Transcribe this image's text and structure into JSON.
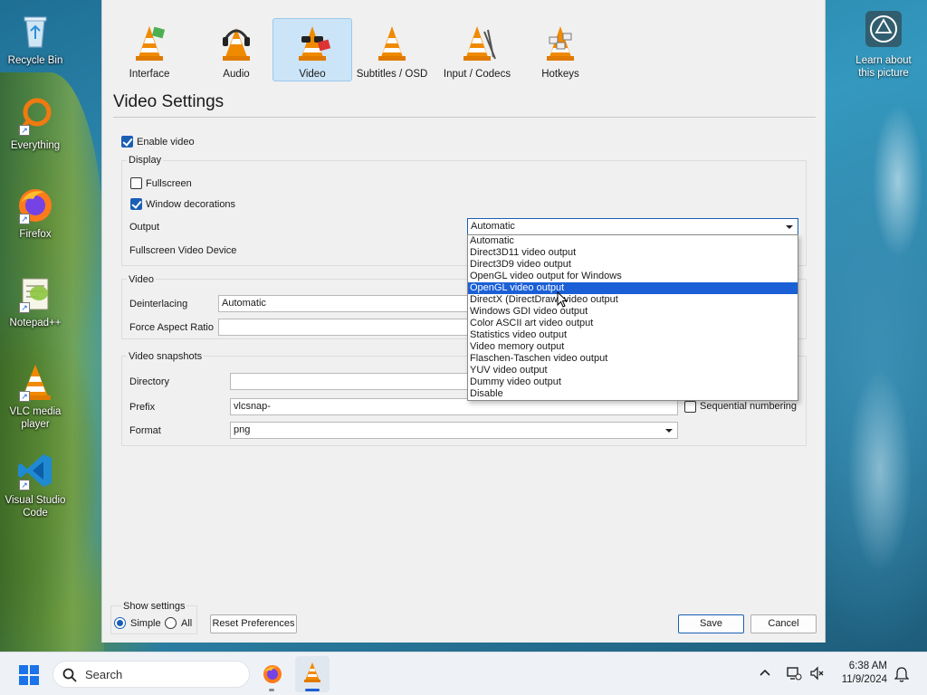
{
  "desktop": {
    "icons": [
      {
        "label": "Recycle Bin",
        "icon": "recycle-bin-icon"
      },
      {
        "label": "Everything",
        "icon": "everything-search-icon"
      },
      {
        "label": "Firefox",
        "icon": "firefox-icon"
      },
      {
        "label": "Notepad++",
        "icon": "notepad-plus-plus-icon"
      },
      {
        "label": "VLC media player",
        "icon": "vlc-cone-icon"
      },
      {
        "label": "Visual Studio Code",
        "icon": "vscode-icon"
      }
    ],
    "learn_label": "Learn about this picture"
  },
  "dialog": {
    "categories": [
      {
        "label": "Interface",
        "selected": false
      },
      {
        "label": "Audio",
        "selected": false
      },
      {
        "label": "Video",
        "selected": true
      },
      {
        "label": "Subtitles / OSD",
        "selected": false
      },
      {
        "label": "Input / Codecs",
        "selected": false
      },
      {
        "label": "Hotkeys",
        "selected": false
      }
    ],
    "page_title": "Video Settings",
    "enable_video": {
      "label": "Enable video",
      "checked": true
    },
    "display": {
      "title": "Display",
      "fullscreen": {
        "label": "Fullscreen",
        "checked": false
      },
      "window_decorations": {
        "label": "Window decorations",
        "checked": true
      },
      "output_label": "Output",
      "output_value": "Automatic",
      "fullscreen_device_label": "Fullscreen Video Device"
    },
    "output_options": [
      "Automatic",
      "Direct3D11 video output",
      "Direct3D9 video output",
      "OpenGL video output for Windows",
      "OpenGL video output",
      "DirectX (DirectDraw) video output",
      "Windows GDI video output",
      "Color ASCII art video output",
      "Statistics video output",
      "Video memory output",
      "Flaschen-Taschen video output",
      "YUV video output",
      "Dummy video output",
      "Disable"
    ],
    "highlighted_option": "OpenGL video output",
    "video": {
      "title": "Video",
      "deinterlacing_label": "Deinterlacing",
      "deinterlacing_value": "Automatic",
      "aspect_label": "Force Aspect Ratio",
      "aspect_value": ""
    },
    "snapshots": {
      "title": "Video snapshots",
      "directory_label": "Directory",
      "directory_value": "",
      "prefix_label": "Prefix",
      "prefix_value": "vlcsnap-",
      "sequential_label": "Sequential numbering",
      "sequential_checked": false,
      "format_label": "Format",
      "format_value": "png"
    },
    "show_settings": {
      "title": "Show settings",
      "simple_label": "Simple",
      "all_label": "All",
      "selected": "Simple"
    },
    "reset_label": "Reset Preferences",
    "save_label": "Save",
    "cancel_label": "Cancel"
  },
  "taskbar": {
    "search_placeholder": "Search",
    "time": "6:38 AM",
    "date": "11/9/2024"
  },
  "colors": {
    "accent": "#1a5fb4",
    "highlight": "#1a5fd6",
    "selected_tab_bg": "#cce4f7",
    "vlc_orange": "#f08a00"
  }
}
